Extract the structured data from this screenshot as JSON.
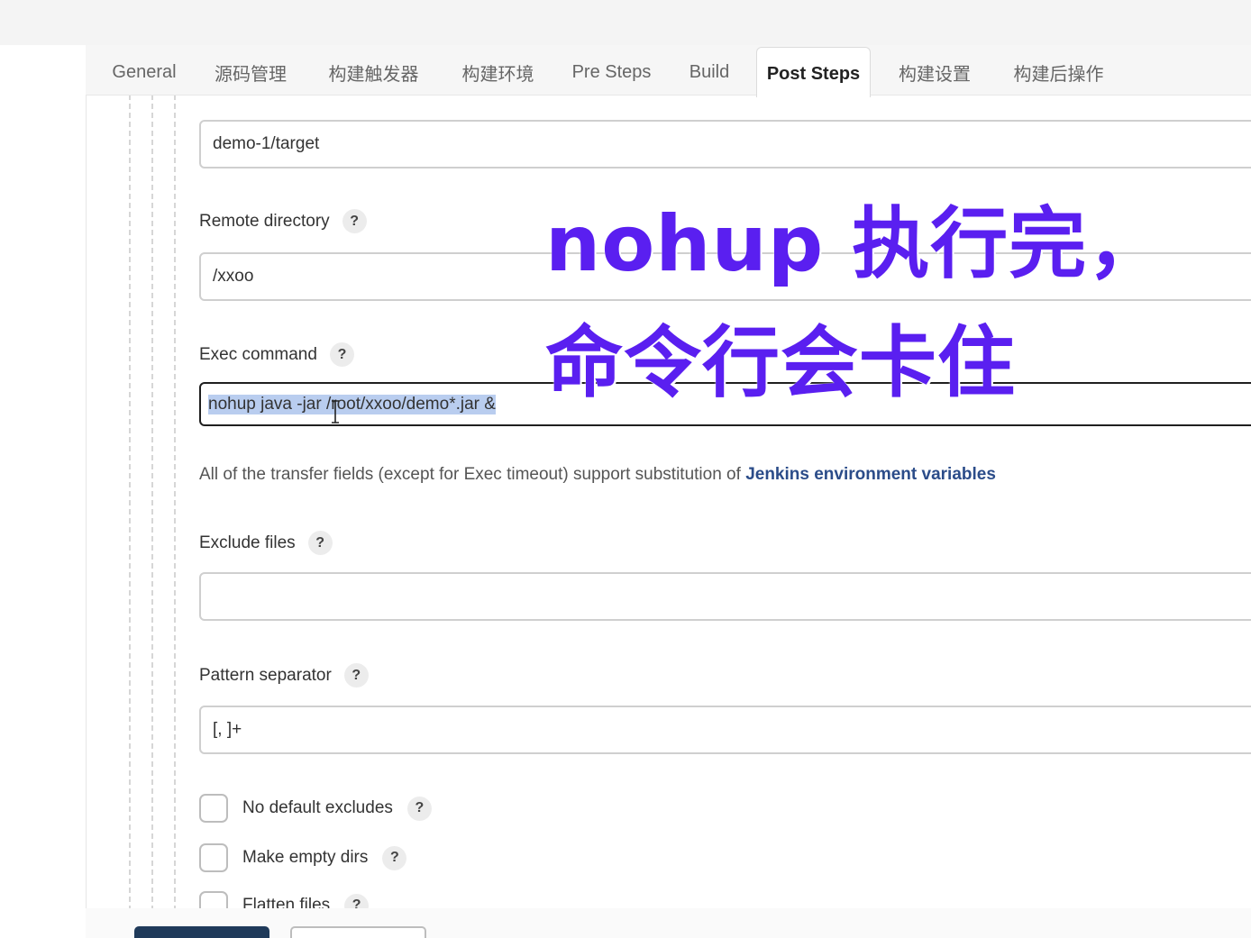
{
  "tabs": [
    {
      "label": "General"
    },
    {
      "label": "源码管理"
    },
    {
      "label": "构建触发器"
    },
    {
      "label": "构建环境"
    },
    {
      "label": "Pre Steps"
    },
    {
      "label": "Build"
    },
    {
      "label": "Post Steps",
      "active": true
    },
    {
      "label": "构建设置"
    },
    {
      "label": "构建后操作"
    }
  ],
  "fields": {
    "source_prefix": {
      "value": "demo-1/target"
    },
    "remote_directory": {
      "label": "Remote directory",
      "value": "/xxoo"
    },
    "exec_command": {
      "label": "Exec command",
      "value": "nohup java -jar /root/xxoo/demo*.jar &"
    },
    "exclude_files": {
      "label": "Exclude files",
      "value": ""
    },
    "pattern_separator": {
      "label": "Pattern separator",
      "value": "[, ]+"
    }
  },
  "help_glyph": "?",
  "help_note": {
    "text": "All of the transfer fields (except for Exec timeout) support substitution of ",
    "link": "Jenkins environment variables"
  },
  "checkboxes": [
    {
      "label": "No default excludes",
      "checked": false
    },
    {
      "label": "Make empty dirs",
      "checked": false
    },
    {
      "label": "Flatten files",
      "checked": false
    }
  ],
  "overlay": {
    "line1": "nohup 执行完，",
    "line2": "命令行会卡住",
    "color": "#5a1ff0"
  },
  "colors": {
    "link": "#2b4c89",
    "primary_button": "#1f3a5a",
    "selection": "#b9cdef"
  }
}
